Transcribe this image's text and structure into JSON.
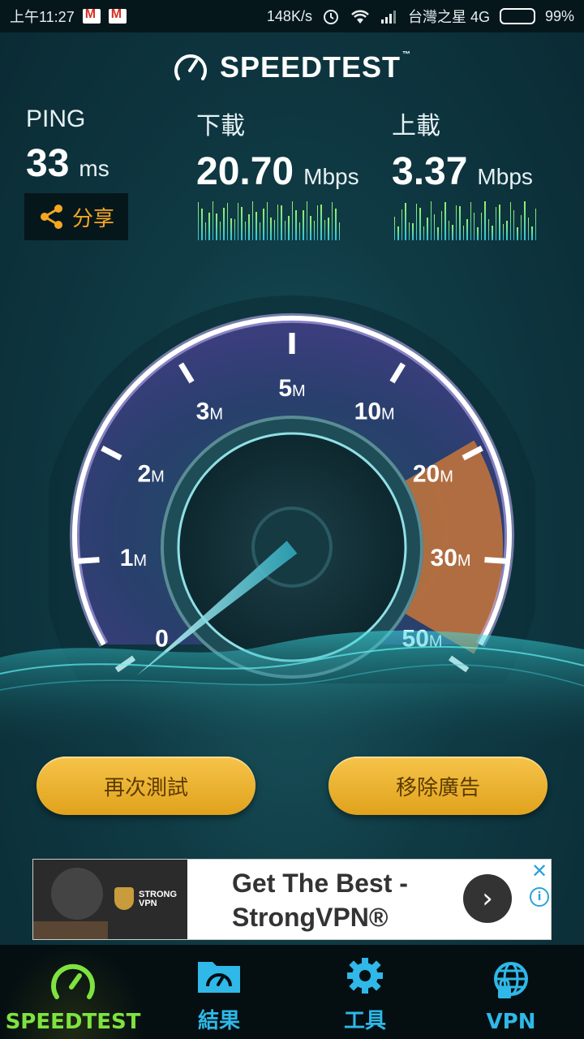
{
  "status_bar": {
    "time": "上午11:27",
    "net_speed": "148K/s",
    "carrier": "台灣之星 4G",
    "battery": "99%",
    "battery_level": 0.99
  },
  "header": {
    "title": "SPEEDTEST",
    "trademark": "™"
  },
  "stats": {
    "ping": {
      "label": "PING",
      "value": "33",
      "unit": "ms"
    },
    "download": {
      "label": "下載",
      "value": "20.70",
      "unit": "Mbps"
    },
    "upload": {
      "label": "上載",
      "value": "3.37",
      "unit": "Mbps"
    }
  },
  "share": {
    "label": "分享"
  },
  "gauge": {
    "ticks": [
      {
        "num": "0",
        "unit": ""
      },
      {
        "num": "1",
        "unit": "M"
      },
      {
        "num": "2",
        "unit": "M"
      },
      {
        "num": "3",
        "unit": "M"
      },
      {
        "num": "5",
        "unit": "M"
      },
      {
        "num": "10",
        "unit": "M"
      },
      {
        "num": "20",
        "unit": "M"
      },
      {
        "num": "30",
        "unit": "M"
      },
      {
        "num": "50",
        "unit": "M"
      }
    ],
    "needle_value_mbps": 0
  },
  "buttons": {
    "retest": "再次測試",
    "remove_ads": "移除廣告"
  },
  "ad": {
    "headline_line1": "Get The Best -",
    "headline_line2": "StrongVPN®",
    "brand_line1": "STRONG",
    "brand_line2": "VPN",
    "close": "✕",
    "info": "i"
  },
  "nav": [
    {
      "label": "SPEEDTEST",
      "icon": "speedometer-icon",
      "active": true
    },
    {
      "label": "結果",
      "icon": "results-folder-icon",
      "active": false
    },
    {
      "label": "工具",
      "icon": "gear-icon",
      "active": false
    },
    {
      "label": "VPN",
      "icon": "globe-lock-icon",
      "active": false
    }
  ]
}
